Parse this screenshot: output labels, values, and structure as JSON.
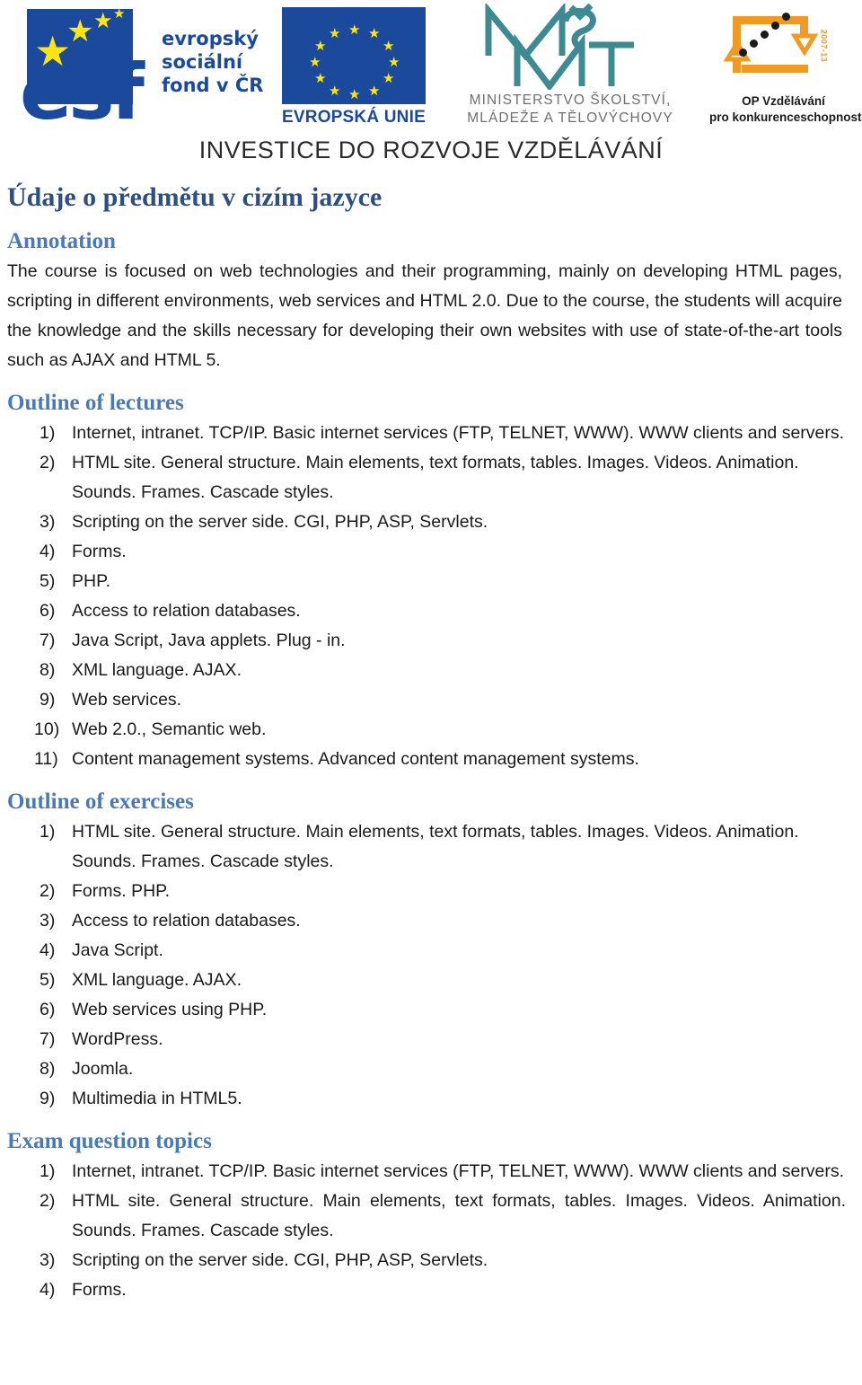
{
  "header": {
    "esf": {
      "line1": "evropský",
      "line2": "sociální",
      "line3": "fond v ČR",
      "wordmark": "esf"
    },
    "eu": {
      "caption": "EVROPSKÁ UNIE"
    },
    "msmt": {
      "caption_line1": "MINISTERSTVO ŠKOLSTVÍ,",
      "caption_line2": "MLÁDEŽE A TĚLOVÝCHOVY"
    },
    "op": {
      "caption_line1": "OP Vzdělávání",
      "caption_line2": "pro konkurenceschopnost",
      "years": "2007-13"
    },
    "banner": "INVESTICE DO ROZVOJE VZDĚLÁVÁNÍ",
    "colors": {
      "eu_blue": "#1b4a9c",
      "eu_yellow": "#ffe511",
      "msmt_teal": "#3e8a93",
      "op_orange": "#f09a23"
    }
  },
  "document": {
    "title": "Údaje o předmětu v cizím jazyce",
    "annotation": {
      "heading": "Annotation",
      "text": "The course is focused on web technologies and their programming, mainly on developing HTML pages, scripting in different environments, web services and HTML 2.0. Due to the course, the students will acquire the knowledge and the skills necessary for developing their own websites with use of state-of-the-art tools such as AJAX and HTML 5."
    },
    "outline_of_lectures": {
      "heading": "Outline of lectures",
      "items": [
        "Internet, intranet. TCP/IP. Basic internet services (FTP, TELNET, WWW). WWW clients and servers.",
        "HTML site. General structure. Main elements, text formats, tables. Images. Videos. Animation. Sounds. Frames. Cascade styles.",
        "Scripting on the server side. CGI, PHP, ASP, Servlets.",
        "Forms.",
        "PHP.",
        "Access to relation databases.",
        "Java Script, Java applets. Plug - in.",
        "XML language. AJAX.",
        "Web services.",
        "Web 2.0., Semantic web.",
        "Content management systems. Advanced content management systems."
      ],
      "markers": [
        "1)",
        "2)",
        "3)",
        "4)",
        "5)",
        "6)",
        "7)",
        "8)",
        "9)",
        "10)",
        "11)"
      ]
    },
    "outline_of_exercises": {
      "heading": "Outline of exercises",
      "items": [
        "HTML site. General structure. Main elements, text formats, tables. Images. Videos. Animation. Sounds. Frames. Cascade styles.",
        "Forms. PHP.",
        "Access to relation databases.",
        "Java Script.",
        "XML language. AJAX.",
        "Web services using PHP.",
        "WordPress.",
        "Joomla.",
        "Multimedia in HTML5."
      ],
      "markers": [
        "1)",
        "2)",
        "3)",
        "4)",
        "5)",
        "6)",
        "7)",
        "8)",
        "9)"
      ]
    },
    "exam_question_topics": {
      "heading": "Exam question topics",
      "items": [
        "Internet, intranet. TCP/IP. Basic internet services (FTP, TELNET, WWW). WWW clients and servers.",
        "HTML site. General structure. Main elements, text formats, tables. Images. Videos. Animation. Sounds. Frames. Cascade styles.",
        "Scripting on the server side. CGI, PHP, ASP, Servlets.",
        "Forms."
      ],
      "markers": [
        "1)",
        "2)",
        "3)",
        "4)"
      ]
    },
    "colors": {
      "title_blue": "#2e4f7f",
      "heading_blue": "#4a7ab5",
      "body_text": "#1a1a1a"
    }
  }
}
